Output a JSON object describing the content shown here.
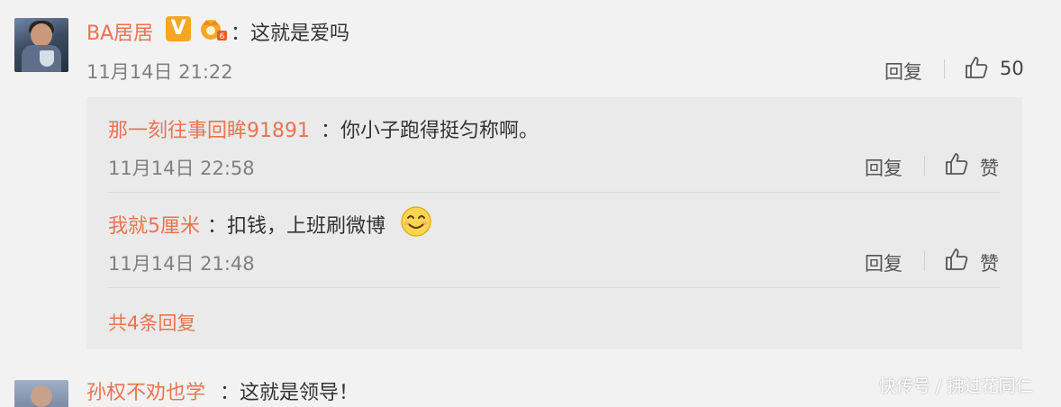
{
  "comment": {
    "username": "BA居居",
    "text": "：这就是爱吗",
    "time": "11月14日 21:22",
    "reply_label": "回复",
    "like_count": "50"
  },
  "replies": [
    {
      "username": "那一刻往事回眸91891",
      "text": "：你小子跑得挺匀称啊。",
      "time": "11月14日 22:58",
      "reply_label": "回复",
      "like_label": "赞"
    },
    {
      "username": "我就5厘米",
      "text": "：扣钱，上班刷微博",
      "time": "11月14日 21:48",
      "reply_label": "回复",
      "like_label": "赞"
    }
  ],
  "more_replies": "共4条回复",
  "next_comment": {
    "username": "孙权不劝也学",
    "text": "：这就是领导！"
  },
  "watermark": "快传号 / 拂过花同仁",
  "colors": {
    "username": "#eb7350",
    "badge_v": "#f5a623",
    "reply_bg": "#eaeaea"
  }
}
